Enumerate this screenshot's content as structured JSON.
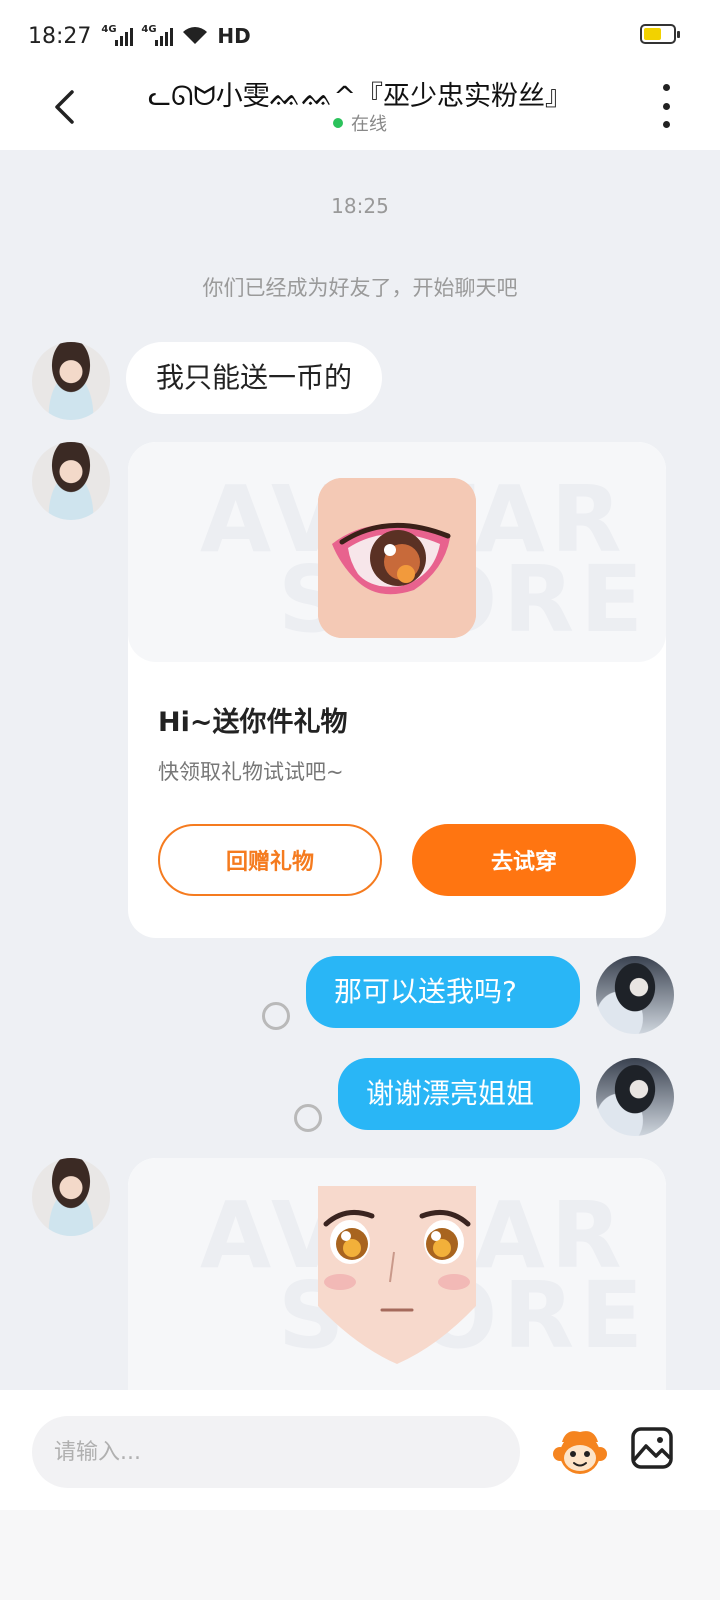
{
  "status_bar": {
    "time": "18:27",
    "signal1": "4G",
    "signal2": "4G",
    "hd": "HD",
    "battery_level": 0.6,
    "battery_color": "#f2d200"
  },
  "header": {
    "title": "ᓚᘏᗢ小雯ᨐᨐ^『巫少忠实粉丝』",
    "status": "在线",
    "back_icon": "chevron-left-icon",
    "more_icon": "more-vertical-icon"
  },
  "chat": {
    "timestamp": "18:25",
    "system_message": "你们已经成为好友了，开始聊天吧",
    "messages": [
      {
        "from": "her",
        "text": "我只能送一币的"
      },
      {
        "from": "her",
        "type": "gift",
        "title": "Hi~送你件礼物",
        "subtitle": "快领取礼物试试吧~",
        "watermark_line1": "AVATAR",
        "watermark_line2": "STORE",
        "button_secondary": "回赠礼物",
        "button_primary": "去试穿"
      },
      {
        "from": "me",
        "text": "那可以送我吗?"
      },
      {
        "from": "me",
        "text": "谢谢漂亮姐姐"
      },
      {
        "from": "her",
        "type": "gift",
        "watermark_line1": "AVATAR",
        "watermark_line2": "STORE"
      }
    ]
  },
  "input": {
    "placeholder": "请输入...",
    "emoji_icon": "monkey-emoji-icon",
    "image_icon": "image-icon"
  },
  "colors": {
    "accent_blue": "#29b6f6",
    "accent_orange": "#ff7511",
    "online_green": "#2bc25b"
  }
}
